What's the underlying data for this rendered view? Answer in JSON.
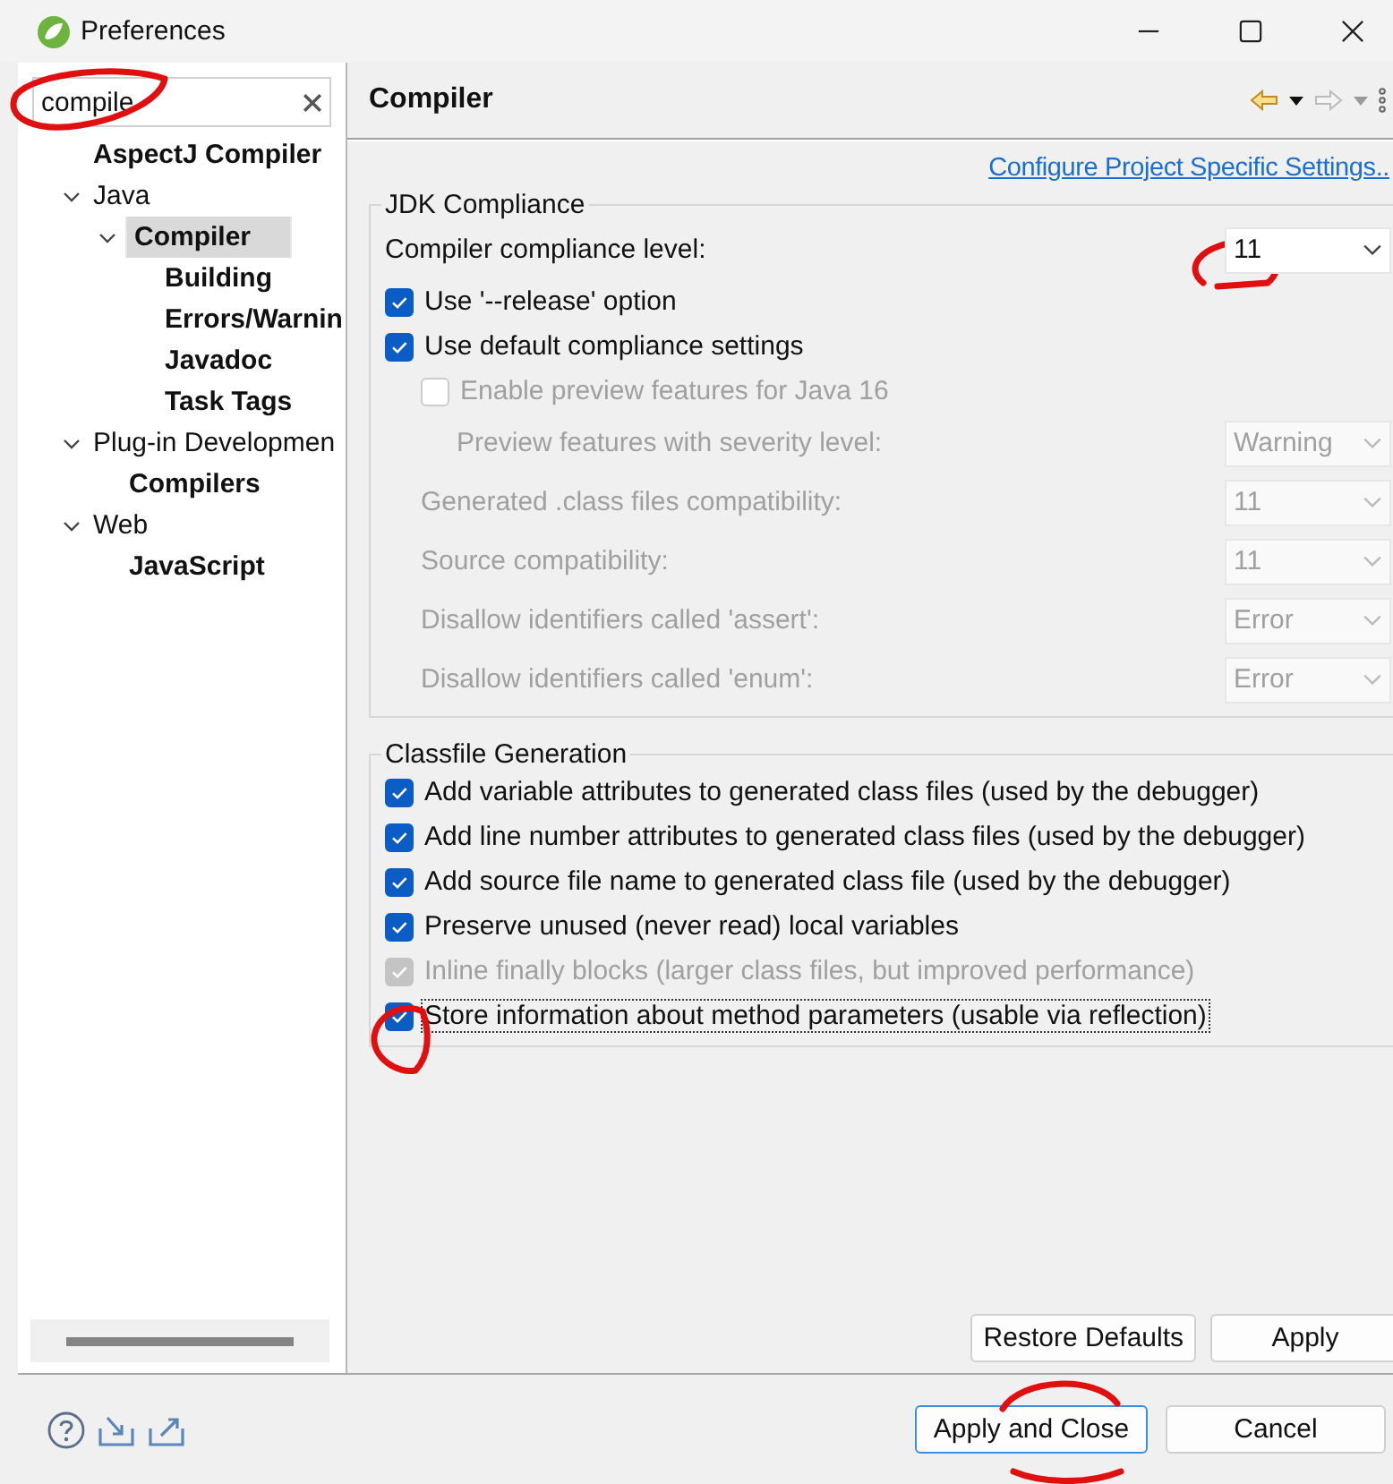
{
  "window": {
    "title": "Preferences"
  },
  "sidebar": {
    "search": {
      "value": "compile"
    },
    "tree": [
      {
        "label": "AspectJ Compiler",
        "bold": true,
        "selected": false
      },
      {
        "label": "Java",
        "bold": false,
        "selected": false,
        "expanded": true,
        "children": [
          {
            "label": "Compiler",
            "bold": true,
            "selected": true,
            "expanded": true,
            "children": [
              {
                "label": "Building",
                "bold": true,
                "selected": false
              },
              {
                "label": "Errors/Warnin",
                "bold": true,
                "selected": false
              },
              {
                "label": "Javadoc",
                "bold": true,
                "selected": false
              },
              {
                "label": "Task Tags",
                "bold": true,
                "selected": false
              }
            ]
          }
        ]
      },
      {
        "label": "Plug-in Developmen",
        "bold": false,
        "selected": false,
        "expanded": true,
        "children": [
          {
            "label": "Compilers",
            "bold": true,
            "selected": false
          }
        ]
      },
      {
        "label": "Web",
        "bold": false,
        "selected": false,
        "expanded": true,
        "children": [
          {
            "label": "JavaScript",
            "bold": true,
            "selected": false
          }
        ]
      }
    ]
  },
  "page": {
    "title": "Compiler",
    "link": "Configure Project Specific Settings..",
    "groups": [
      {
        "title": "JDK Compliance",
        "rows": [
          {
            "kind": "select",
            "label": "Compiler compliance level:",
            "value": "11",
            "disabled": false
          },
          {
            "kind": "checkbox",
            "label": "Use '--release' option",
            "checked": true,
            "disabled": false,
            "focused": false
          },
          {
            "kind": "checkbox",
            "label": "Use default compliance settings",
            "checked": true,
            "disabled": false,
            "focused": false,
            "children": [
              {
                "kind": "checkbox",
                "label": "Enable preview features for Java 16",
                "checked": false,
                "disabled": true,
                "focused": false,
                "children": [
                  {
                    "kind": "select",
                    "label": "Preview features with severity level:",
                    "value": "Warning",
                    "disabled": true
                  }
                ]
              },
              {
                "kind": "select",
                "label": "Generated .class files compatibility:",
                "value": "11",
                "disabled": true
              },
              {
                "kind": "select",
                "label": "Source compatibility:",
                "value": "11",
                "disabled": true
              },
              {
                "kind": "select",
                "label": "Disallow identifiers called 'assert':",
                "value": "Error",
                "disabled": true
              },
              {
                "kind": "select",
                "label": "Disallow identifiers called 'enum':",
                "value": "Error",
                "disabled": true
              }
            ]
          }
        ]
      },
      {
        "title": "Classfile Generation",
        "rows": [
          {
            "kind": "checkbox",
            "label": "Add variable attributes to generated class files (used by the debugger)",
            "checked": true,
            "disabled": false,
            "focused": false
          },
          {
            "kind": "checkbox",
            "label": "Add line number attributes to generated class files (used by the debugger)",
            "checked": true,
            "disabled": false,
            "focused": false
          },
          {
            "kind": "checkbox",
            "label": "Add source file name to generated class file (used by the debugger)",
            "checked": true,
            "disabled": false,
            "focused": false
          },
          {
            "kind": "checkbox",
            "label": "Preserve unused (never read) local variables",
            "checked": true,
            "disabled": false,
            "focused": false
          },
          {
            "kind": "checkbox",
            "label": "Inline finally blocks (larger class files, but improved performance)",
            "checked": true,
            "disabled": true,
            "focused": false
          },
          {
            "kind": "checkbox",
            "label": "Store information about method parameters (usable via reflection)",
            "checked": true,
            "disabled": false,
            "focused": true
          }
        ]
      }
    ],
    "buttons": [
      "Restore Defaults",
      "Apply"
    ]
  },
  "footer": {
    "buttons": [
      {
        "label": "Apply and Close",
        "default": true
      },
      {
        "label": "Cancel",
        "default": false
      }
    ]
  }
}
